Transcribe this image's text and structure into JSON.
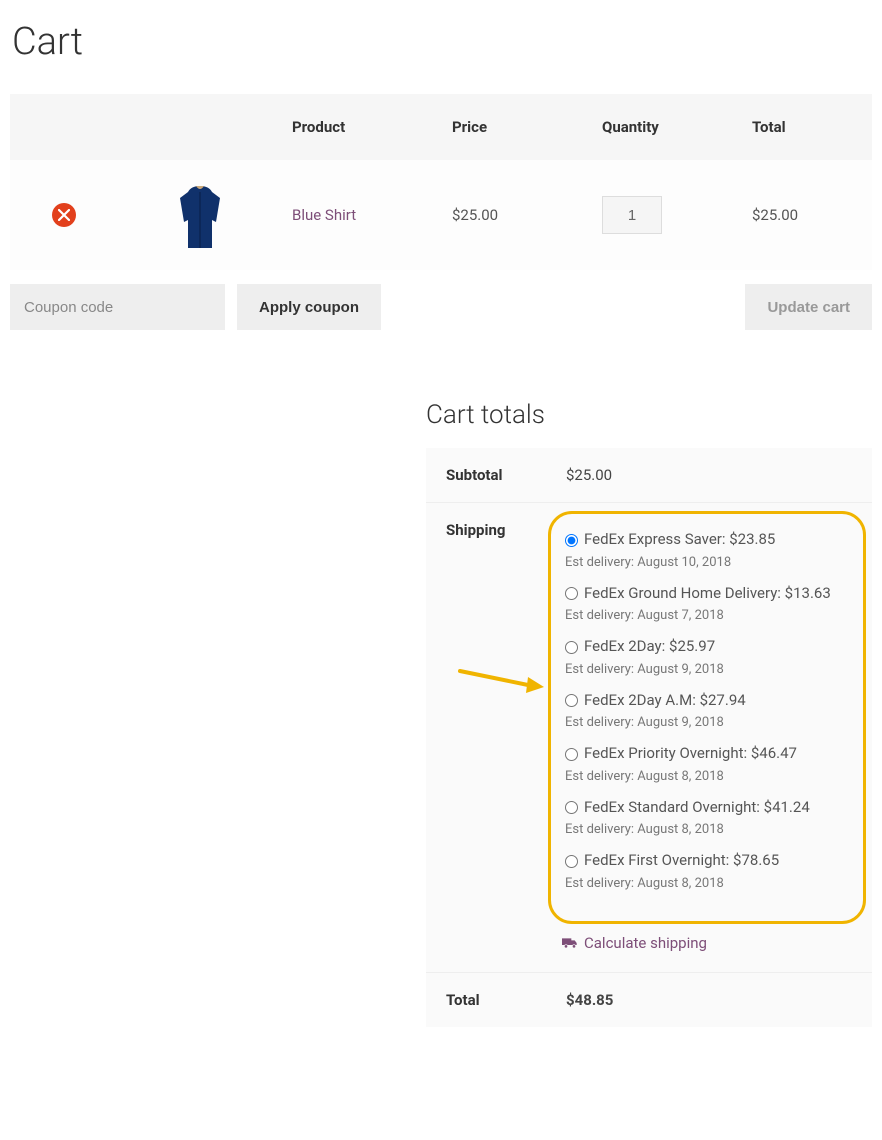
{
  "page": {
    "title": "Cart"
  },
  "table": {
    "headers": {
      "product": "Product",
      "price": "Price",
      "quantity": "Quantity",
      "total": "Total"
    },
    "row": {
      "product_name": "Blue Shirt",
      "price": "$25.00",
      "quantity": "1",
      "total": "$25.00"
    }
  },
  "coupon": {
    "placeholder": "Coupon code",
    "apply_label": "Apply coupon",
    "update_label": "Update cart"
  },
  "totals": {
    "title": "Cart totals",
    "subtotal_label": "Subtotal",
    "subtotal_value": "$25.00",
    "shipping_label": "Shipping",
    "options": [
      {
        "label": "FedEx Express Saver: $23.85",
        "est": "Est delivery: August 10, 2018",
        "selected": true
      },
      {
        "label": "FedEx Ground Home Delivery: $13.63",
        "est": "Est delivery: August 7, 2018",
        "selected": false
      },
      {
        "label": "FedEx 2Day: $25.97",
        "est": "Est delivery: August 9, 2018",
        "selected": false
      },
      {
        "label": "FedEx 2Day A.M: $27.94",
        "est": "Est delivery: August 9, 2018",
        "selected": false
      },
      {
        "label": "FedEx Priority Overnight: $46.47",
        "est": "Est delivery: August 8, 2018",
        "selected": false
      },
      {
        "label": "FedEx Standard Overnight: $41.24",
        "est": "Est delivery: August 8, 2018",
        "selected": false
      },
      {
        "label": "FedEx First Overnight: $78.65",
        "est": "Est delivery: August 8, 2018",
        "selected": false
      }
    ],
    "calc_label": "Calculate shipping",
    "total_label": "Total",
    "total_value": "$48.85"
  }
}
